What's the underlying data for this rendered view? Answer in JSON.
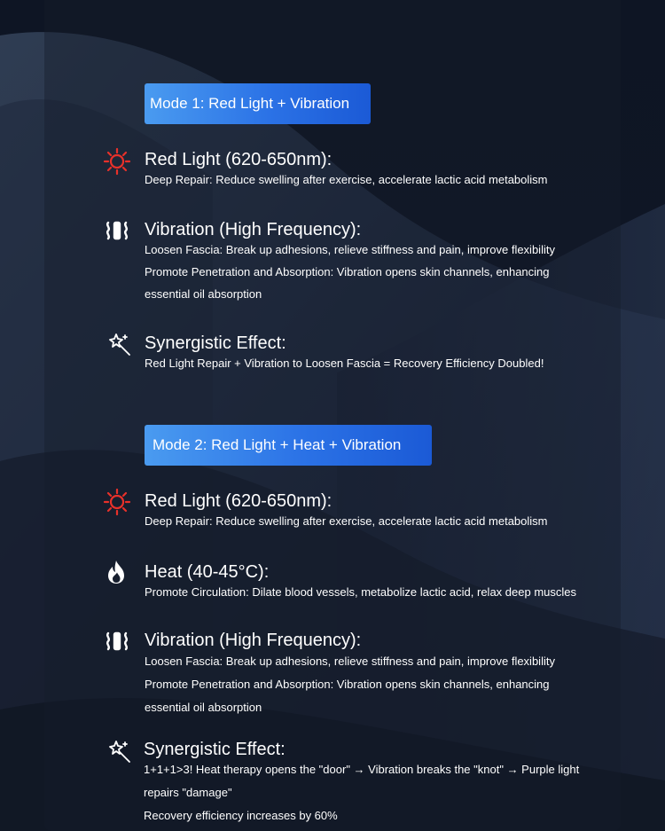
{
  "mode1": {
    "badge": "Mode 1: Red Light + Vibration",
    "red_light": {
      "title": "Red Light (620-650nm):",
      "desc": "Deep Repair: Reduce swelling after exercise, accelerate lactic acid metabolism"
    },
    "vibration": {
      "title": "Vibration (High Frequency):",
      "lines": [
        "Loosen Fascia: Break up adhesions, relieve stiffness and pain, improve flexibility",
        "Promote Penetration and Absorption: Vibration opens skin channels, enhancing",
        "essential oil absorption"
      ]
    },
    "synergy": {
      "title": "Synergistic Effect:",
      "desc": "Red Light Repair + Vibration to Loosen Fascia = Recovery Efficiency Doubled!"
    }
  },
  "mode2": {
    "badge": "Mode 2: Red Light + Heat + Vibration",
    "red_light": {
      "title": "Red Light (620-650nm):",
      "desc": "Deep Repair: Reduce swelling after exercise, accelerate lactic acid metabolism"
    },
    "heat": {
      "title": "Heat (40-45°C):",
      "desc": "Promote Circulation: Dilate blood vessels, metabolize lactic acid, relax deep muscles"
    },
    "vibration": {
      "title": "Vibration (High Frequency):",
      "lines": [
        "Loosen Fascia: Break up adhesions, relieve stiffness and pain, improve flexibility",
        "Promote Penetration and Absorption: Vibration opens skin channels, enhancing",
        "essential oil absorption"
      ]
    },
    "synergy": {
      "title": "Synergistic Effect:",
      "lines": [
        "1+1+1>3! Heat therapy opens the \"door\" → Vibration breaks the \"knot\" → Purple light",
        "repairs \"damage\"",
        "Recovery efficiency increases by 60%"
      ]
    }
  },
  "colors": {
    "badge_gradient_start": "#4a9bf0",
    "badge_gradient_end": "#1b5ad6",
    "red_light_icon": "#e8312a",
    "background": "#131a28"
  },
  "icons": {
    "red_light": "sun-icon",
    "vibration": "vibration-icon",
    "heat": "flame-icon",
    "synergy": "magic-wand-icon"
  }
}
